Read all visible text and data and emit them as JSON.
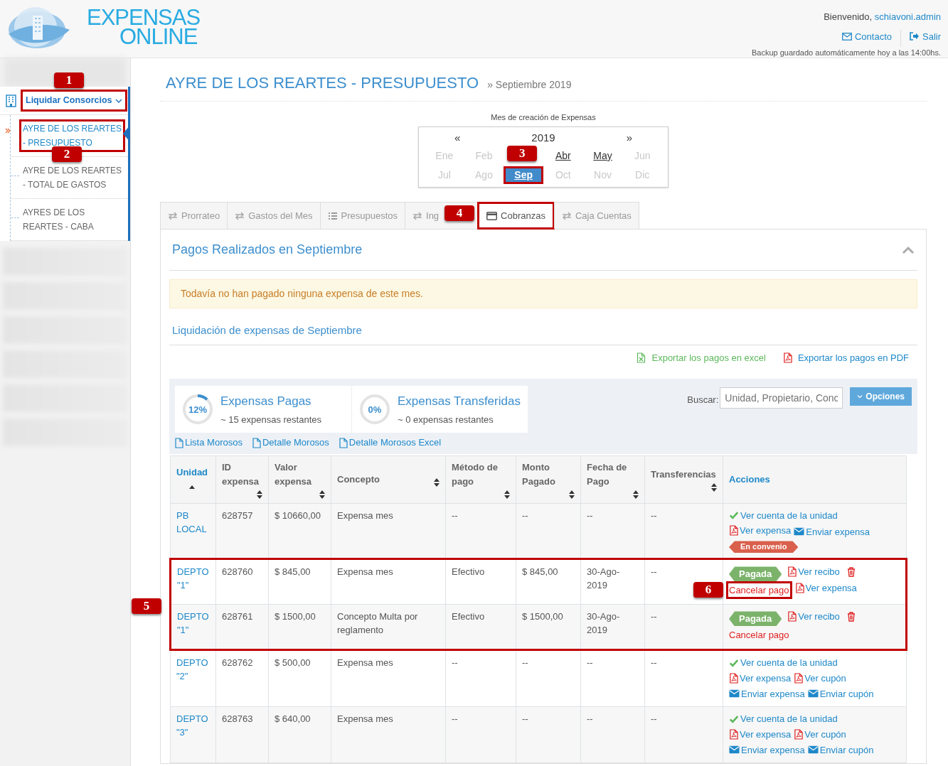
{
  "header": {
    "logo_line1": "EXPENSAS",
    "logo_line2": "ONLINE",
    "welcome": "Bienvenido,",
    "user": "schiavoni.admin",
    "links": [
      {
        "label": "Contacto",
        "kind": "mail"
      },
      {
        "label": "Salir",
        "kind": "signout"
      }
    ],
    "backup_note": "Backup guardado automáticamente hoy a las 14:00hs."
  },
  "sidebar": {
    "section": {
      "label": "Liquidar Consorcios",
      "expanded": true,
      "highlighted": true,
      "callout": "1"
    },
    "items": [
      {
        "label": "AYRE DE LOS REARTES - PRESUPUESTO",
        "selected": true,
        "highlighted": true,
        "callout": "2"
      },
      {
        "label": "AYRE DE LOS REARTES - TOTAL DE GASTOS",
        "selected": false,
        "highlighted": false
      },
      {
        "label": "AYRES DE LOS REARTES - CABA",
        "selected": false,
        "highlighted": false
      }
    ],
    "redacted": [
      {
        "kind": "blurred"
      },
      {
        "kind": "blurred"
      },
      {
        "kind": "blurred"
      },
      {
        "kind": "blurred"
      },
      {
        "kind": "blurred"
      },
      {
        "kind": "blurred"
      }
    ]
  },
  "page": {
    "title": "AYRE DE LOS REARTES - PRESUPUESTO",
    "breadcrumb": "» Septiembre 2019"
  },
  "calendar": {
    "caption": "Mes de creación de Expensas",
    "prev": "«",
    "year": "2019",
    "next": "»",
    "months": [
      {
        "label": "Ene",
        "disabled": true,
        "selected": false
      },
      {
        "label": "Feb",
        "disabled": true,
        "selected": false
      },
      {
        "kind": "covered",
        "callout": "3"
      },
      {
        "label": "Abr",
        "disabled": false,
        "selected": false
      },
      {
        "label": "May",
        "disabled": false,
        "selected": false
      },
      {
        "label": "Jun",
        "disabled": true,
        "selected": false
      },
      {
        "label": "Jul",
        "disabled": true,
        "selected": false
      },
      {
        "label": "Ago",
        "disabled": true,
        "selected": false
      },
      {
        "label": "Sep",
        "disabled": false,
        "selected": true,
        "highlighted": true
      },
      {
        "label": "Oct",
        "disabled": true,
        "selected": false
      },
      {
        "label": "Nov",
        "disabled": true,
        "selected": false
      },
      {
        "label": "Dic",
        "disabled": true,
        "selected": false
      }
    ]
  },
  "tabs": [
    {
      "label": "Prorrateo",
      "kind": "transfer",
      "selected": false
    },
    {
      "label": "Gastos del Mes",
      "kind": "transfer",
      "selected": false
    },
    {
      "label": "Presupuestos",
      "kind": "list",
      "selected": false
    },
    {
      "label": "Ing",
      "kind": "transfer",
      "selected": false
    },
    {
      "label": "Cobranzas",
      "kind": "payments",
      "selected": true,
      "highlighted": true,
      "callout": "4"
    },
    {
      "label": "Caja Cuentas",
      "kind": "transfer",
      "selected": false
    }
  ],
  "panel": {
    "title": "Pagos Realizados en Septiembre",
    "expanded": true,
    "alert": "Todavía no han pagado ninguna expensa de este mes.",
    "subtitle": "Liquidación de expensas de Septiembre",
    "exports": [
      {
        "label": "Exportar los pagos en excel",
        "kind": "excel"
      },
      {
        "label": "Exportar los pagos en PDF",
        "kind": "pdf"
      }
    ]
  },
  "stats": [
    {
      "percent": "12%",
      "level": 0.12,
      "title": "Expensas Pagas",
      "subtitle": "~ 15 expensas restantes"
    },
    {
      "percent": "0%",
      "level": 0,
      "title": "Expensas Transferidas",
      "subtitle": "~ 0 expensas restantes"
    }
  ],
  "reports": [
    "Lista Morosos",
    "Detalle Morosos",
    "Detalle Morosos Excel"
  ],
  "search": {
    "label": "Buscar:",
    "placeholder": "Unidad, Propietario, Conc"
  },
  "options_button": "Opciones",
  "table": {
    "columns": [
      {
        "label": "Unidad",
        "sortable": true,
        "sorted": true
      },
      {
        "label": "ID expensa",
        "sortable": true,
        "sorted": false
      },
      {
        "label": "Valor expensa",
        "sortable": true,
        "sorted": false
      },
      {
        "label": "Concepto",
        "sortable": true,
        "sorted": false
      },
      {
        "label": "Método de pago",
        "sortable": true,
        "sorted": false
      },
      {
        "label": "Monto Pagado",
        "sortable": true,
        "sorted": false
      },
      {
        "label": "Fecha de Pago",
        "sortable": true,
        "sorted": false
      },
      {
        "label": "Transferencias",
        "sortable": true,
        "sorted": false
      },
      {
        "label": "Acciones",
        "sortable": false,
        "sorted": false
      }
    ],
    "rows": [
      {
        "cells": [
          "PB LOCAL",
          "628757",
          "$ 10660,00",
          "Expensa mes",
          "--",
          "--",
          "--",
          "--"
        ],
        "highlighted": false,
        "actions": [
          {
            "kind": "check",
            "label": "Ver cuenta de la unidad"
          },
          {
            "kind": "pdf",
            "label": "Ver expensa"
          },
          {
            "kind": "mail",
            "label": "Enviar expensa"
          },
          {
            "kind": "convenio",
            "label": "En convenio"
          }
        ]
      },
      {
        "cells": [
          "DEPTO \"1\"",
          "628760",
          "$ 845,00",
          "Expensa mes",
          "Efectivo",
          "$ 845,00",
          "30-Ago-2019",
          "--"
        ],
        "highlighted": true,
        "callout": "5",
        "actions": [
          {
            "kind": "paid",
            "label": "Pagada"
          },
          {
            "kind": "pdf",
            "label": "Ver recibo"
          },
          {
            "kind": "delete"
          },
          {
            "kind": "cancel",
            "label": "Cancelar pago",
            "highlighted": true,
            "callout": "6"
          },
          {
            "kind": "pdf",
            "label": "Ver expensa"
          }
        ]
      },
      {
        "cells": [
          "DEPTO \"1\"",
          "628761",
          "$ 1500,00",
          "Concepto Multa por reglamento",
          "Efectivo",
          "$ 1500,00",
          "30-Ago-2019",
          "--"
        ],
        "highlighted": true,
        "actions": [
          {
            "kind": "paid",
            "label": "Pagada"
          },
          {
            "kind": "pdf",
            "label": "Ver recibo"
          },
          {
            "kind": "delete"
          },
          {
            "kind": "cancel",
            "label": "Cancelar pago"
          }
        ]
      },
      {
        "cells": [
          "DEPTO \"2\"",
          "628762",
          "$ 500,00",
          "Expensa mes",
          "--",
          "--",
          "--",
          "--"
        ],
        "highlighted": false,
        "actions": [
          {
            "kind": "check",
            "label": "Ver cuenta de la unidad"
          },
          {
            "kind": "pdf",
            "label": "Ver expensa"
          },
          {
            "kind": "pdf",
            "label": "Ver cupón"
          },
          {
            "kind": "mail",
            "label": "Enviar expensa"
          },
          {
            "kind": "mail",
            "label": "Enviar cupón"
          }
        ]
      },
      {
        "cells": [
          "DEPTO \"3\"",
          "628763",
          "$ 640,00",
          "Expensa mes",
          "--",
          "--",
          "--",
          "--"
        ],
        "highlighted": false,
        "actions": [
          {
            "kind": "check",
            "label": "Ver cuenta de la unidad"
          },
          {
            "kind": "pdf",
            "label": "Ver expensa"
          },
          {
            "kind": "pdf",
            "label": "Ver cupón"
          },
          {
            "kind": "mail",
            "label": "Enviar expensa"
          },
          {
            "kind": "mail",
            "label": "Enviar cupón"
          }
        ]
      }
    ]
  }
}
